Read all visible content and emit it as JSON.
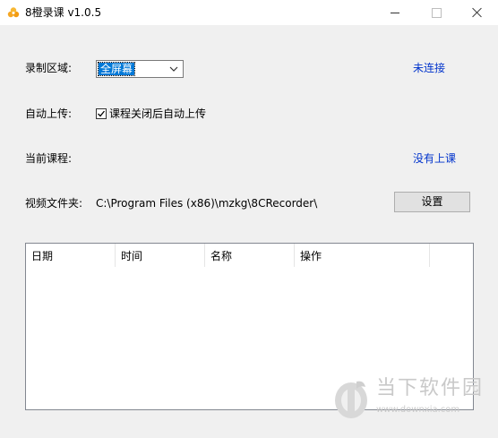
{
  "window": {
    "title": "8橙录课 v1.0.5"
  },
  "form": {
    "record_area_label": "录制区域:",
    "record_area_value": "全屏幕",
    "connection_status": "未连接",
    "auto_upload_label": "自动上传:",
    "auto_upload_checkbox_label": "课程关闭后自动上传",
    "auto_upload_checked": true,
    "current_course_label": "当前课程:",
    "course_status": "没有上课",
    "video_folder_label": "视频文件夹:",
    "video_folder_path": "C:\\Program Files (x86)\\mzkg\\8CRecorder\\",
    "settings_button": "设置"
  },
  "table": {
    "columns": [
      "日期",
      "时间",
      "名称",
      "操作"
    ],
    "rows": []
  },
  "watermark": {
    "title": "当下软件园",
    "url": "www.downxia.com"
  },
  "colors": {
    "link": "#0033cc",
    "selection": "#0078d7"
  },
  "icons": {
    "app": "orange-logo-icon",
    "dropdown": "chevron-down-icon",
    "check": "checkmark-icon"
  }
}
